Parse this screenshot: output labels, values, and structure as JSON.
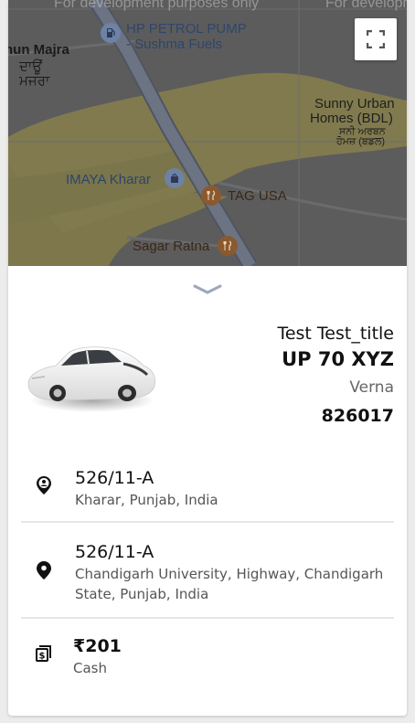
{
  "map": {
    "watermark_left": "For development purposes only",
    "watermark_right": "For developme",
    "labels": {
      "village_en": "hun Majra",
      "village_pa_1": "ਦਾਊਂ",
      "village_pa_2": "ਮਜਰਾ",
      "petrol_1": "HP PETROL PUMP",
      "petrol_2": "- Sushma Fuels",
      "urban_1": "Sunny Urban",
      "urban_2": "Homes (BDL)",
      "urban_pa_1": "ਸਨੀ ਅਰਬਨ",
      "urban_pa_2": "ਹੋਮਜ਼ (ਬਡਲ)",
      "imaya": "IMAYA Kharar",
      "tag": "TAG USA",
      "sagar": "Sagar Ratna"
    },
    "icons": [
      "gas-station-icon",
      "shopping-bag-icon",
      "restaurant-icon"
    ]
  },
  "vehicle": {
    "driver_name": "Test Test_title",
    "plate": "UP 70 XYZ",
    "model": "Verna",
    "otp": "826017"
  },
  "trip": {
    "pickup": {
      "title": "526/11-A",
      "address": "Kharar, Punjab, India"
    },
    "drop": {
      "title": "526/11-A",
      "address": "Chandigarh University, Highway, Chandigarh State, Punjab, India"
    },
    "fare": {
      "amount": "₹201",
      "method": "Cash"
    }
  },
  "colors": {
    "map_dim": "#5b5c5d",
    "map_yellow": "#807a4d",
    "map_road": "#6c7484",
    "map_poi_text": "#a4c8e4",
    "map_food": "#8a5a2e"
  }
}
